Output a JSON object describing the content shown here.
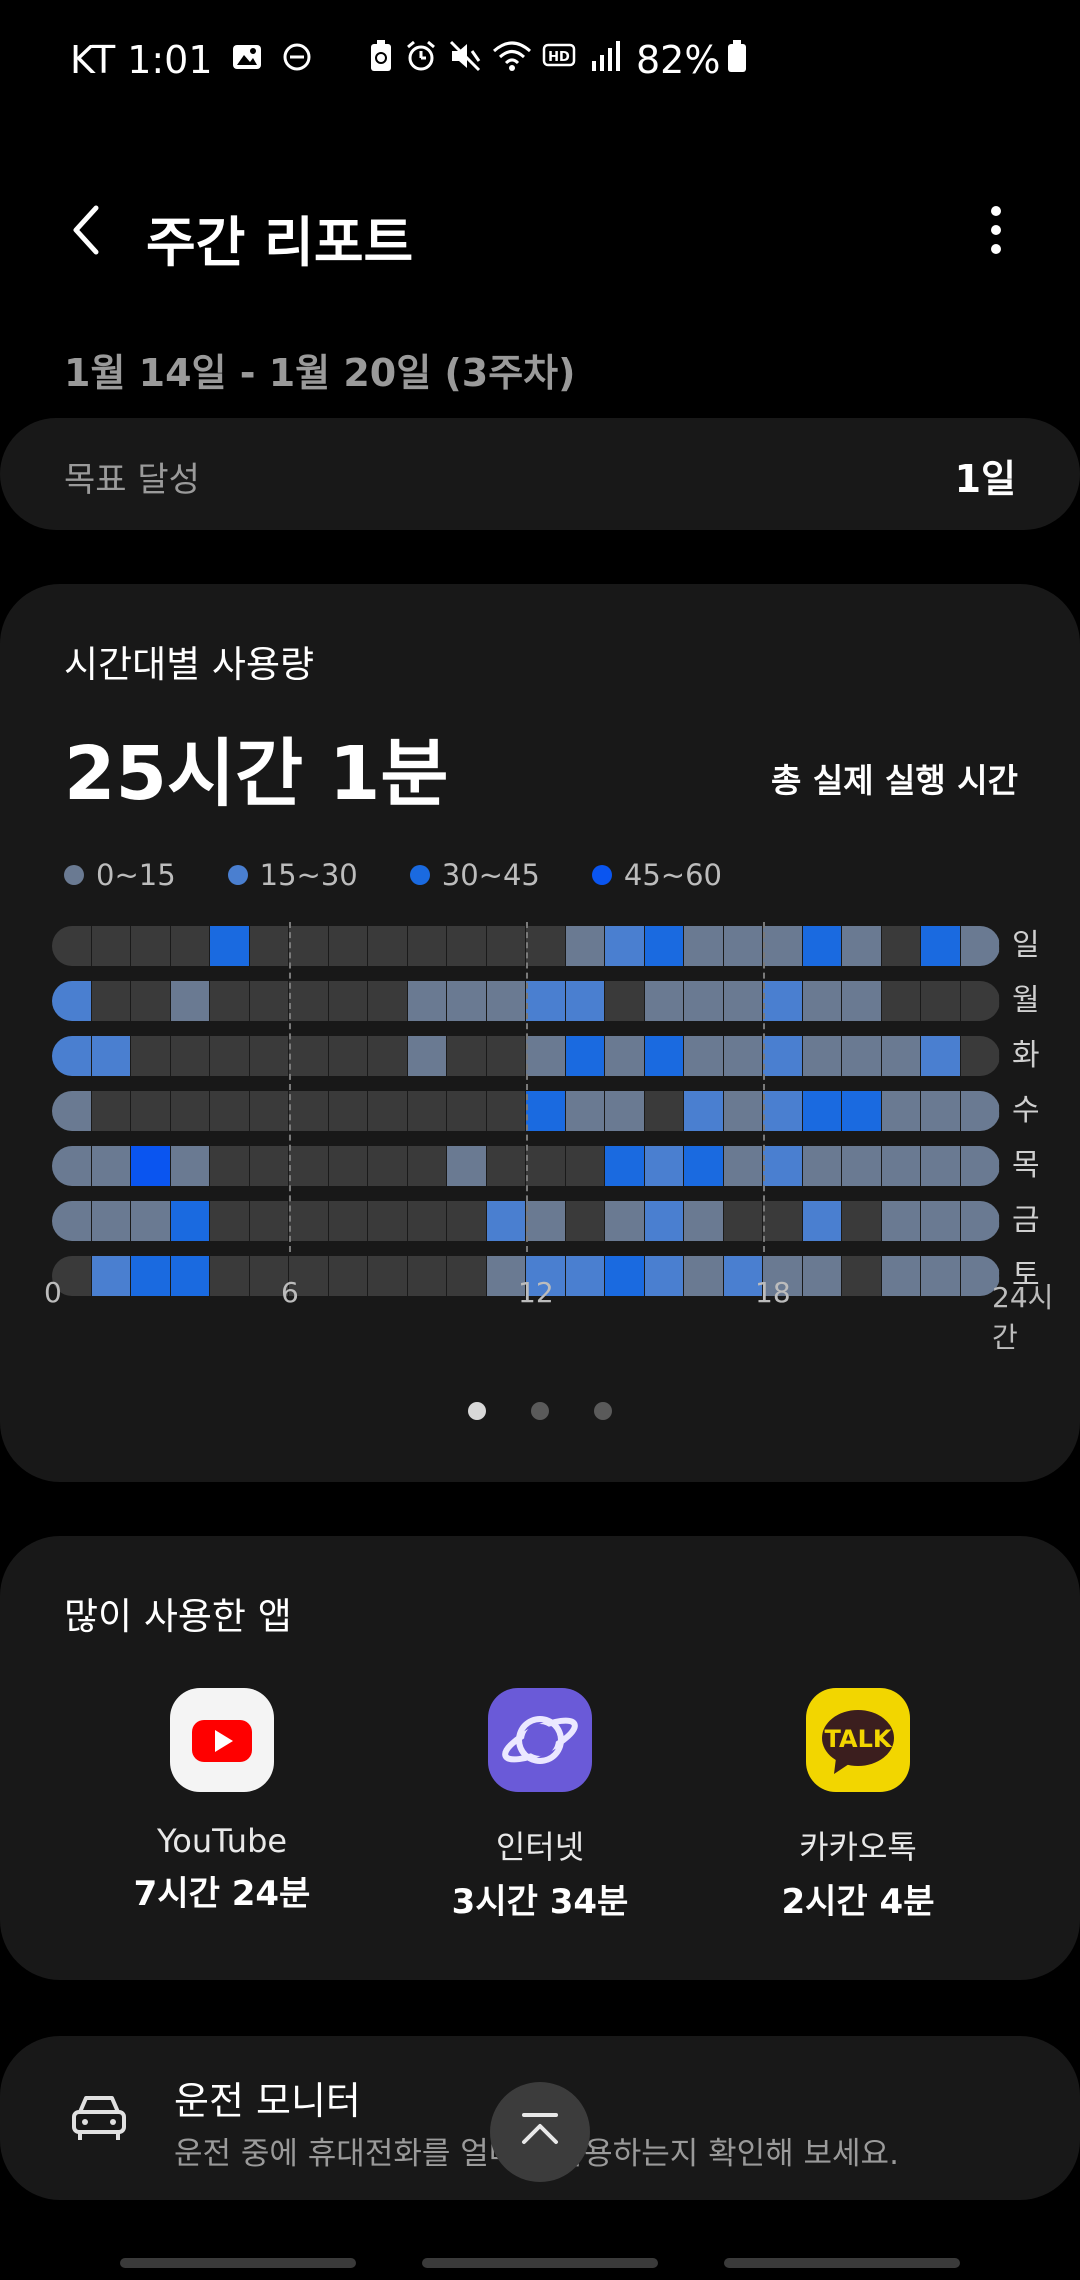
{
  "status_bar": {
    "carrier": "KT",
    "time": "1:01",
    "battery": "82%",
    "icons": [
      "gallery-icon",
      "dnd-icon",
      "battery-saver-icon",
      "alarm-icon",
      "mute-icon",
      "wifi-icon",
      "hd-icon",
      "signal-icon",
      "battery-icon"
    ]
  },
  "header": {
    "title": "주간 리포트",
    "back_icon": "back-icon",
    "more_icon": "more-vertical-icon"
  },
  "date_range": "1월 14일 - 1월 20일 (3주차)",
  "goal": {
    "label": "목표 달성",
    "value": "1일"
  },
  "usage": {
    "title": "시간대별 사용량",
    "total": "25시간 1분",
    "subtitle": "총 실제 실행 시간",
    "legend": [
      {
        "label": "0~15",
        "color": "#6a7a92"
      },
      {
        "label": "15~30",
        "color": "#4a7fd0"
      },
      {
        "label": "30~45",
        "color": "#1a6ae0"
      },
      {
        "label": "45~60",
        "color": "#0a55f0"
      }
    ]
  },
  "chart_data": {
    "type": "heatmap",
    "title": "시간대별 사용량",
    "rows": [
      "일",
      "월",
      "화",
      "수",
      "목",
      "금",
      "토"
    ],
    "x_ticks": [
      "0",
      "6",
      "12",
      "18",
      "24시간"
    ],
    "columns": 24,
    "levels": [
      "none",
      "0~15",
      "15~30",
      "30~45",
      "45~60"
    ],
    "values": [
      [
        0,
        0,
        0,
        0,
        3,
        0,
        0,
        0,
        0,
        0,
        0,
        0,
        0,
        1,
        2,
        3,
        1,
        1,
        1,
        3,
        1,
        0,
        3,
        1
      ],
      [
        2,
        0,
        0,
        1,
        0,
        0,
        0,
        0,
        0,
        1,
        1,
        1,
        2,
        2,
        0,
        1,
        1,
        1,
        2,
        1,
        1,
        0,
        0,
        0
      ],
      [
        2,
        2,
        0,
        0,
        0,
        0,
        0,
        0,
        0,
        1,
        0,
        0,
        1,
        3,
        1,
        3,
        1,
        1,
        2,
        1,
        1,
        1,
        2,
        0
      ],
      [
        1,
        0,
        0,
        0,
        0,
        0,
        0,
        0,
        0,
        0,
        0,
        0,
        3,
        1,
        1,
        0,
        2,
        1,
        2,
        3,
        3,
        1,
        1,
        1
      ],
      [
        1,
        1,
        4,
        1,
        0,
        0,
        0,
        0,
        0,
        0,
        1,
        0,
        0,
        0,
        3,
        2,
        3,
        1,
        2,
        1,
        1,
        1,
        1,
        1
      ],
      [
        1,
        1,
        1,
        3,
        0,
        0,
        0,
        0,
        0,
        0,
        0,
        2,
        1,
        0,
        1,
        2,
        1,
        0,
        0,
        2,
        0,
        1,
        1,
        1
      ],
      [
        0,
        2,
        3,
        3,
        0,
        0,
        0,
        0,
        0,
        0,
        0,
        1,
        2,
        2,
        3,
        2,
        1,
        2,
        1,
        1,
        0,
        1,
        1,
        1
      ]
    ],
    "colors": [
      "#3a3a3a",
      "#6a7a92",
      "#4a7fd0",
      "#1a6ae0",
      "#0a55f0"
    ]
  },
  "pager": {
    "count": 3,
    "active": 0
  },
  "top_apps": {
    "title": "많이 사용한 앱",
    "apps": [
      {
        "name": "YouTube",
        "time": "7시간 24분",
        "icon": "youtube-icon"
      },
      {
        "name": "인터넷",
        "time": "3시간 34분",
        "icon": "samsung-internet-icon"
      },
      {
        "name": "카카오톡",
        "time": "2시간 4분",
        "icon": "kakaotalk-icon",
        "icon_text": "TALK"
      }
    ]
  },
  "driving": {
    "title": "운전 모니터",
    "desc": "운전 중에 휴대전화를 얼마나 사용하는지 확인해 보세요.",
    "icon": "car-icon"
  },
  "scroll_top_icon": "chevron-up-icon"
}
